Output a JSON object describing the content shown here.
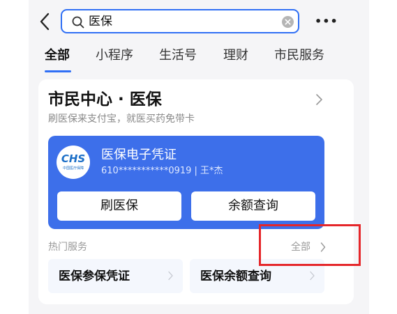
{
  "header": {
    "back_icon": "chevron-left-icon",
    "search": {
      "value": "医保",
      "icon": "search-icon",
      "clear_icon": "clear-icon"
    },
    "more_label": "•••"
  },
  "tabs": [
    {
      "label": "全部",
      "active": true
    },
    {
      "label": "小程序",
      "active": false
    },
    {
      "label": "生活号",
      "active": false
    },
    {
      "label": "理财",
      "active": false
    },
    {
      "label": "市民服务",
      "active": false
    }
  ],
  "card": {
    "title": "市民中心 · 医保",
    "subtitle": "刷医保来支付宝，就医买药免带卡",
    "logo": {
      "text": "CHS",
      "subtext": "中国医疗保障"
    },
    "certificate": {
      "name": "医保电子凭证",
      "id_line": "610***********0919 | 王*杰"
    },
    "buttons": {
      "swipe": "刷医保",
      "balance": "余额查询"
    },
    "hot_services": {
      "label": "热门服务",
      "all_link": "全部",
      "items": [
        {
          "label": "医保参保凭证"
        },
        {
          "label": "医保余额查询"
        }
      ]
    }
  },
  "colors": {
    "accent": "#2f6ff5",
    "panel": "#3d6fea",
    "highlight": "#e5262a"
  }
}
